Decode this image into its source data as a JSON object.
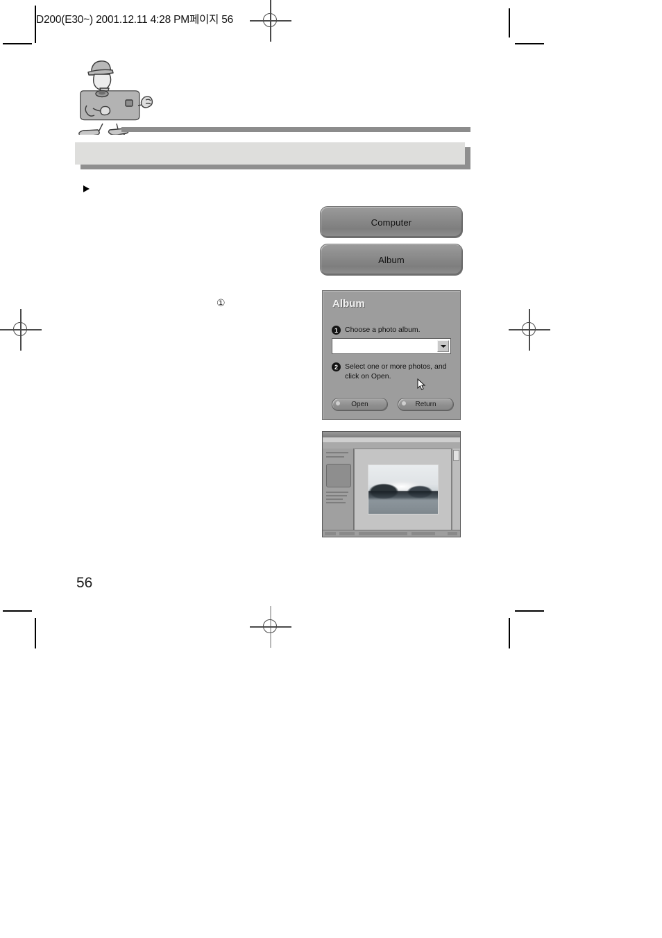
{
  "prepress": {
    "slug": "D200(E30~)  2001.12.11  4:28 PM페이지 56",
    "registration_icon": "registration-mark"
  },
  "page": {
    "number": "56"
  },
  "mascot": {
    "icon": "camera-mascot-illustration",
    "alt": "Cartoon camera character wearing a hat"
  },
  "section": {
    "title": "",
    "bullet_icon": "triangle-bullet",
    "bullet_text": "",
    "step_marker": "①"
  },
  "tabs": [
    {
      "label": "Computer",
      "name": "computer"
    },
    {
      "label": "Album",
      "name": "album"
    }
  ],
  "album_dialog": {
    "title": "Album",
    "steps": [
      {
        "badge": "1",
        "text": "Choose a photo album."
      },
      {
        "badge": "2",
        "text": "Select one or more photos, and click on Open."
      }
    ],
    "combo": {
      "value": "",
      "placeholder": "",
      "arrow_icon": "chevron-down-icon"
    },
    "cursor_icon": "mouse-pointer-icon",
    "buttons": [
      {
        "label": "Open",
        "name": "open"
      },
      {
        "label": "Return",
        "name": "return"
      }
    ]
  },
  "app_screenshot": {
    "alt": "Photo viewer application window displaying a mountain lake landscape photograph",
    "photo_alt": "Black and white mountain and lake landscape"
  },
  "colors": {
    "band_fill": "#dededc",
    "band_shadow": "#8f8f8f",
    "rule": "#8c8c8c",
    "dialog_bg": "#9d9d9d",
    "button_face": "#8e8e8e",
    "mark": "#4a4a4a"
  }
}
